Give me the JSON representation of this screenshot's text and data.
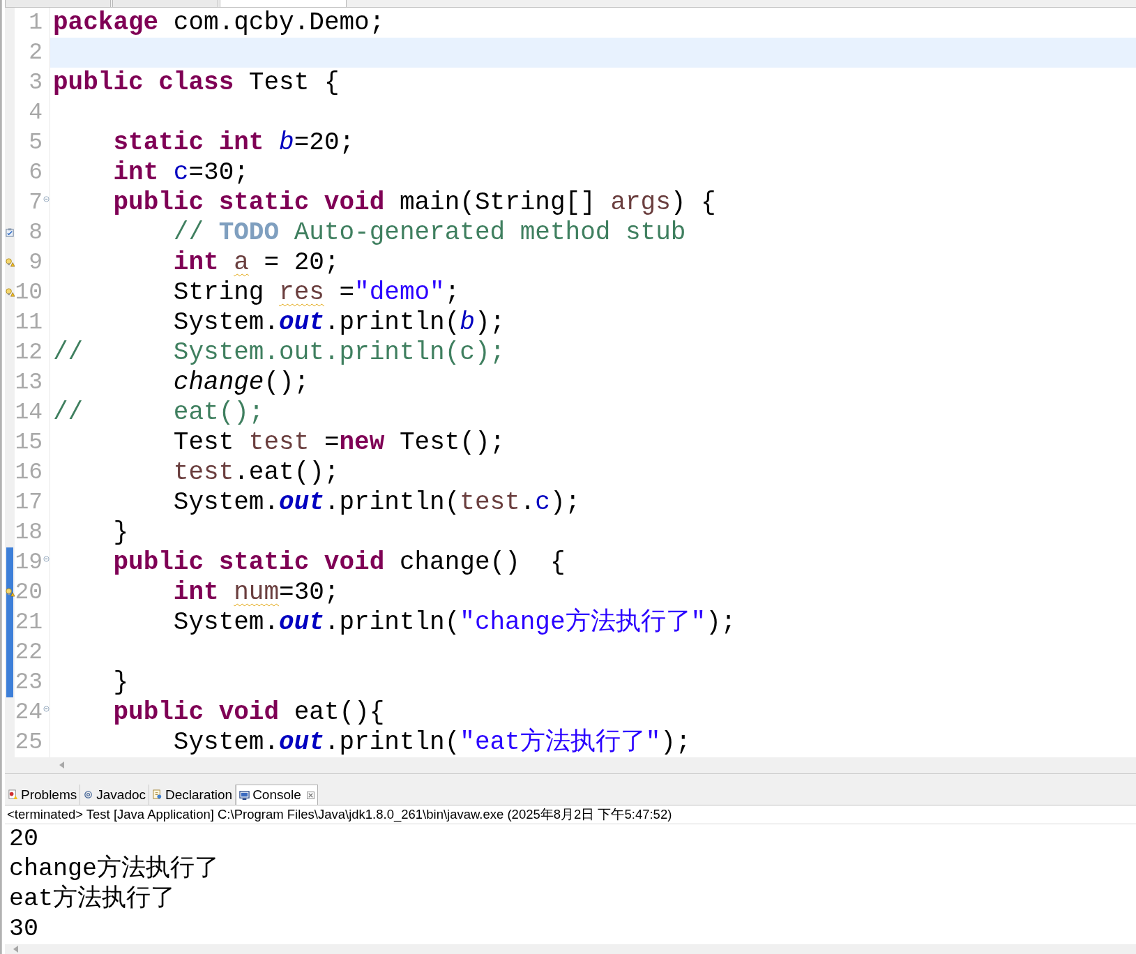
{
  "editor_tabs": [
    {
      "selected": false
    },
    {
      "selected": false
    },
    {
      "selected": true
    }
  ],
  "editor": {
    "lines": [
      {
        "number": "1",
        "tokens": [
          {
            "text": "package",
            "kind": "keyword"
          },
          {
            "text": " com.qcby.Demo;",
            "kind": "plain"
          }
        ]
      },
      {
        "number": "2",
        "current": true
      },
      {
        "number": "3",
        "tokens": [
          {
            "text": "public class",
            "kind": "keyword"
          },
          {
            "text": " Test {",
            "kind": "plain"
          }
        ]
      },
      {
        "number": "4"
      },
      {
        "number": "5",
        "tokens": [
          {
            "text": "    static int",
            "kind": "keyword"
          },
          {
            "text": " b",
            "kind": "static-field"
          },
          {
            "text": "=20;",
            "kind": "plain"
          }
        ]
      },
      {
        "number": "6",
        "tokens": [
          {
            "text": "    int",
            "kind": "keyword"
          },
          {
            "text": " c",
            "kind": "field"
          },
          {
            "text": "=30;",
            "kind": "plain"
          }
        ]
      },
      {
        "number": "7",
        "expanded": true,
        "tokens": [
          {
            "text": "    public static void",
            "kind": "keyword"
          },
          {
            "text": " main(String[] ",
            "kind": "plain"
          },
          {
            "text": "args",
            "kind": "local"
          },
          {
            "text": ") {",
            "kind": "plain"
          }
        ]
      },
      {
        "number": "8",
        "task": true,
        "tokens": [
          {
            "text": "        // ",
            "kind": "comment"
          },
          {
            "text": "TODO",
            "kind": "todo"
          },
          {
            "text": " Auto-generated method stub",
            "kind": "comment"
          }
        ]
      },
      {
        "number": "9",
        "warning": true,
        "tokens": [
          {
            "text": "        int",
            "kind": "keyword"
          },
          {
            "text": " a",
            "kind": "unused-local"
          },
          {
            "text": " = 20;",
            "kind": "plain"
          }
        ]
      },
      {
        "number": "10",
        "warning": true,
        "tokens": [
          {
            "text": "        String ",
            "kind": "plain"
          },
          {
            "text": "res",
            "kind": "unused-local"
          },
          {
            "text": " =",
            "kind": "plain"
          },
          {
            "text": "\"demo\"",
            "kind": "string"
          },
          {
            "text": ";",
            "kind": "plain"
          }
        ]
      },
      {
        "number": "11",
        "tokens": [
          {
            "text": "        System.",
            "kind": "plain"
          },
          {
            "text": "out",
            "kind": "static-constant"
          },
          {
            "text": ".println(",
            "kind": "plain"
          },
          {
            "text": "b",
            "kind": "static-field"
          },
          {
            "text": ");",
            "kind": "plain"
          }
        ]
      },
      {
        "number": "12",
        "tokens": [
          {
            "text": "//      System.out.println(c);",
            "kind": "comment"
          }
        ]
      },
      {
        "number": "13",
        "tokens": [
          {
            "text": "        change",
            "kind": "static-method"
          },
          {
            "text": "();",
            "kind": "plain"
          }
        ]
      },
      {
        "number": "14",
        "tokens": [
          {
            "text": "//      eat();",
            "kind": "comment"
          }
        ]
      },
      {
        "number": "15",
        "tokens": [
          {
            "text": "        Test ",
            "kind": "plain"
          },
          {
            "text": "test",
            "kind": "local"
          },
          {
            "text": " =",
            "kind": "plain"
          },
          {
            "text": "new",
            "kind": "keyword"
          },
          {
            "text": " Test();",
            "kind": "plain"
          }
        ]
      },
      {
        "number": "16",
        "tokens": [
          {
            "text": "        test",
            "kind": "local"
          },
          {
            "text": ".eat();",
            "kind": "plain"
          }
        ]
      },
      {
        "number": "17",
        "tokens": [
          {
            "text": "        System.",
            "kind": "plain"
          },
          {
            "text": "out",
            "kind": "static-constant"
          },
          {
            "text": ".println(",
            "kind": "plain"
          },
          {
            "text": "test",
            "kind": "local"
          },
          {
            "text": ".",
            "kind": "plain"
          },
          {
            "text": "c",
            "kind": "field"
          },
          {
            "text": ");",
            "kind": "plain"
          }
        ]
      },
      {
        "number": "18",
        "tokens": [
          {
            "text": "    }",
            "kind": "plain"
          }
        ]
      },
      {
        "number": "19",
        "expanded": true,
        "changed": true,
        "tokens": [
          {
            "text": "    public static void",
            "kind": "keyword"
          },
          {
            "text": " change()  {",
            "kind": "plain"
          }
        ]
      },
      {
        "number": "20",
        "warning": true,
        "changed": true,
        "tokens": [
          {
            "text": "        int",
            "kind": "keyword"
          },
          {
            "text": " num",
            "kind": "unused-local"
          },
          {
            "text": "=30;",
            "kind": "plain"
          }
        ]
      },
      {
        "number": "21",
        "changed": true,
        "tokens": [
          {
            "text": "        System.",
            "kind": "plain"
          },
          {
            "text": "out",
            "kind": "static-constant"
          },
          {
            "text": ".println(",
            "kind": "plain"
          },
          {
            "text": "\"change方法执行了\"",
            "kind": "string"
          },
          {
            "text": ");",
            "kind": "plain"
          }
        ]
      },
      {
        "number": "22",
        "changed": true
      },
      {
        "number": "23",
        "changed": true,
        "tokens": [
          {
            "text": "    }",
            "kind": "plain"
          }
        ]
      },
      {
        "number": "24",
        "expanded": true,
        "tokens": [
          {
            "text": "    public void",
            "kind": "keyword"
          },
          {
            "text": " eat(){",
            "kind": "plain"
          }
        ]
      },
      {
        "number": "25",
        "tokens": [
          {
            "text": "        System.",
            "kind": "plain"
          },
          {
            "text": "out",
            "kind": "static-constant"
          },
          {
            "text": ".println(",
            "kind": "plain"
          },
          {
            "text": "\"eat方法执行了\"",
            "kind": "string"
          },
          {
            "text": ");",
            "kind": "plain"
          }
        ]
      }
    ]
  },
  "view_tabs": [
    {
      "label": "Problems",
      "selected": false
    },
    {
      "label": "Javadoc",
      "selected": false
    },
    {
      "label": "Declaration",
      "selected": false
    },
    {
      "label": "Console",
      "selected": true,
      "closable": true
    }
  ],
  "console": {
    "header": "<terminated> Test [Java Application] C:\\Program Files\\Java\\jdk1.8.0_261\\bin\\javaw.exe (2025年8月2日 下午5:47:52)",
    "output": [
      "20",
      "change方法执行了",
      "eat方法执行了",
      "30"
    ]
  }
}
